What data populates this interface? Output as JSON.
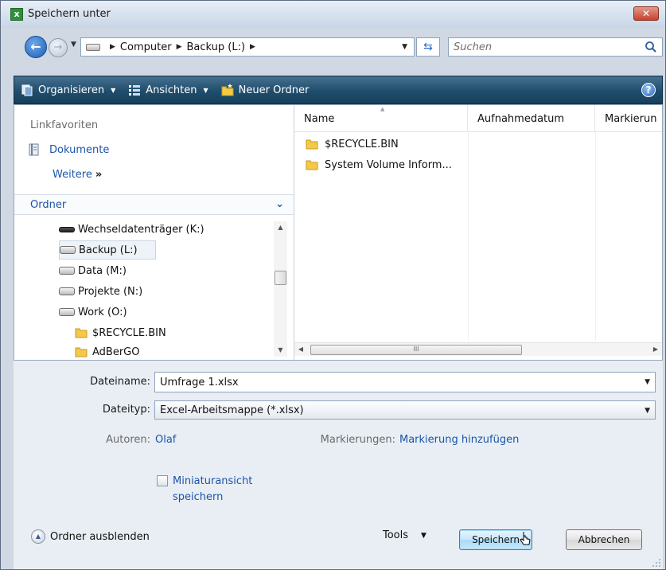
{
  "window": {
    "title": "Speichern unter",
    "app_icon_letter": "x",
    "close_symbol": "✕"
  },
  "navigation": {
    "breadcrumbs": [
      "Computer",
      "Backup (L:)"
    ],
    "search_placeholder": "Suchen"
  },
  "toolbar": {
    "organize_label": "Organisieren",
    "views_label": "Ansichten",
    "new_folder_label": "Neuer Ordner",
    "help_symbol": "?"
  },
  "left_pane": {
    "favorites_title": "Linkfavoriten",
    "favorites": [
      {
        "label": "Dokumente"
      }
    ],
    "more_label": "Weitere",
    "more_symbol": "»",
    "folders_title": "Ordner",
    "tree": [
      {
        "label": "Wechseldatenträger (K:)",
        "icon": "removable-drive-icon"
      },
      {
        "label": "Backup (L:)",
        "icon": "drive-icon",
        "selected": true
      },
      {
        "label": "Data (M:)",
        "icon": "drive-icon"
      },
      {
        "label": "Projekte (N:)",
        "icon": "drive-icon"
      },
      {
        "label": "Work (O:)",
        "icon": "drive-icon"
      },
      {
        "label": "$RECYCLE.BIN",
        "icon": "folder-icon"
      },
      {
        "label": "AdBerGO",
        "icon": "folder-icon"
      }
    ]
  },
  "file_list": {
    "columns": [
      "Name",
      "Aufnahmedatum",
      "Markierun"
    ],
    "items": [
      {
        "name": "$RECYCLE.BIN"
      },
      {
        "name": "System Volume Inform..."
      }
    ],
    "scroll_thumb_symbol": "III"
  },
  "details": {
    "filename_label": "Dateiname:",
    "filename_value": "Umfrage 1.xlsx",
    "filetype_label": "Dateityp:",
    "filetype_value": "Excel-Arbeitsmappe (*.xlsx)",
    "authors_label": "Autoren:",
    "authors_value": "Olaf",
    "tags_label": "Markierungen:",
    "tags_value": "Markierung hinzufügen",
    "thumbnail_label_line1": "Miniaturansicht",
    "thumbnail_label_line2": "speichern",
    "thumbnail_checked": false
  },
  "footer": {
    "hide_folders_label": "Ordner ausblenden",
    "tools_label": "Tools",
    "save_label": "Speichern",
    "cancel_label": "Abbrechen"
  },
  "colors": {
    "toolbar": "#1f4d6c",
    "link": "#1c54a8",
    "details_bg": "#e9eef4"
  }
}
